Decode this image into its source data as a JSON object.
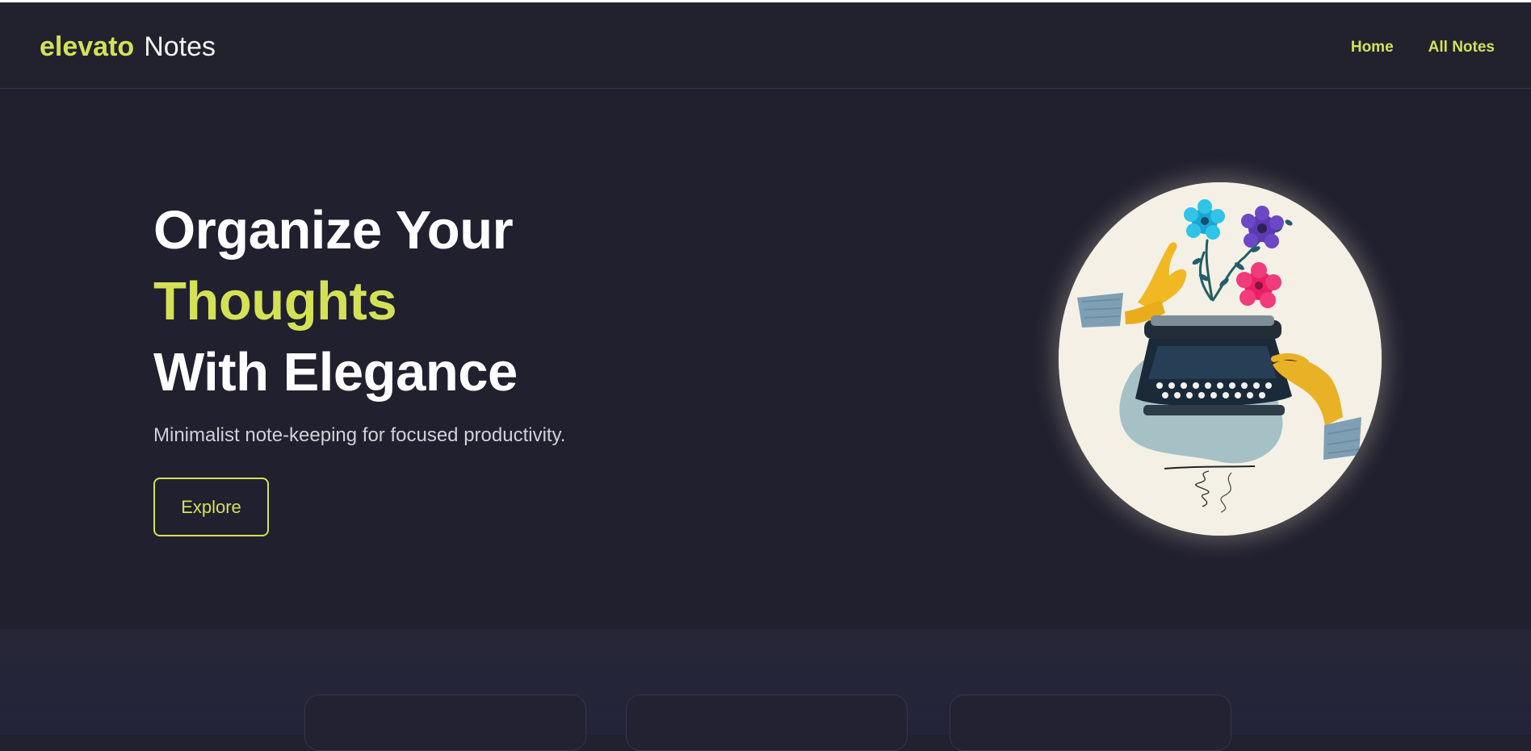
{
  "header": {
    "brand": "elevato",
    "title_suffix": "Notes",
    "nav": [
      {
        "label": "Home"
      },
      {
        "label": "All Notes"
      }
    ]
  },
  "hero": {
    "heading_line_1": "Organize Your",
    "heading_accent": "Thoughts",
    "heading_line_3": "With Elegance",
    "subtitle": "Minimalist note-keeping for focused productivity.",
    "cta_label": "Explore",
    "illustration": "typewriter-with-flowers-and-hands"
  },
  "colors": {
    "background": "#21212f",
    "accent": "#d4e157",
    "text": "#ffffff",
    "muted_text": "#d1d1d9",
    "art_background": "#f4f0e5"
  },
  "icons": {
    "hero_art": "typewriter-illustration"
  },
  "cards": [
    {
      "name": "note-card-preview-1"
    },
    {
      "name": "note-card-preview-2"
    },
    {
      "name": "note-card-preview-3"
    }
  ]
}
